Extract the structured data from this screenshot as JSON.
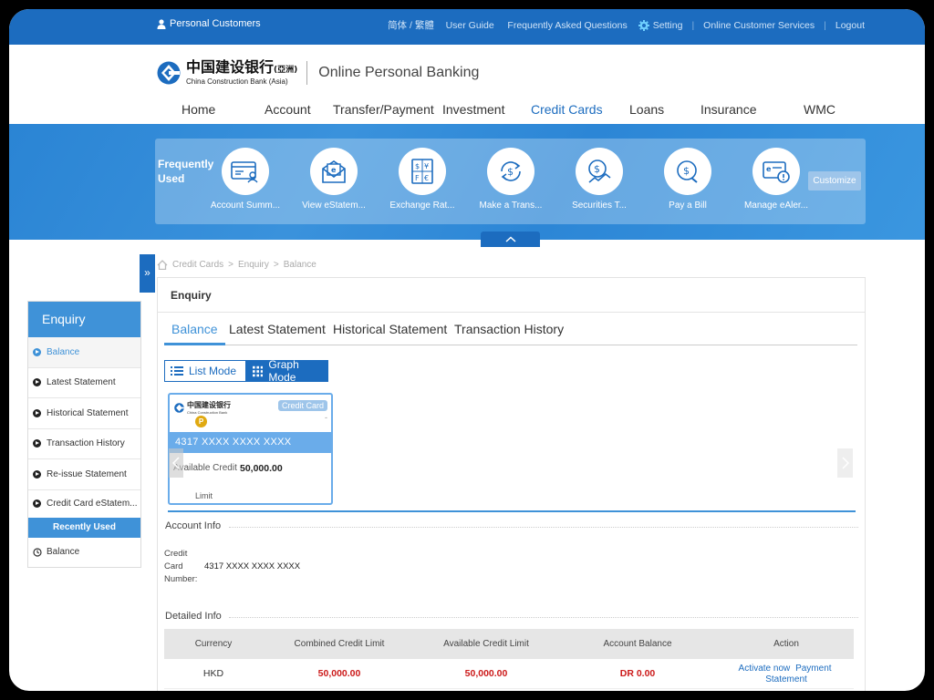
{
  "topbar": {
    "personal": "Personal Customers",
    "lang": "简体 / 繁體",
    "user_guide": "User Guide",
    "faq": "Frequently Asked Questions",
    "setting": "Setting",
    "online_services": "Online Customer Services",
    "logout": "Logout"
  },
  "header": {
    "bank_cn": "中国建设银行",
    "bank_cn_suffix": "(亞洲)",
    "bank_en": "China Construction Bank (Asia)",
    "product": "Online Personal Banking"
  },
  "nav": {
    "home": "Home",
    "account": "Account",
    "transfer": "Transfer/Payment",
    "investment": "Investment",
    "credit_cards": "Credit Cards",
    "loans": "Loans",
    "insurance": "Insurance",
    "wmc": "WMC"
  },
  "frequently_used": {
    "label": "Frequently Used",
    "customize": "Customize",
    "items": [
      {
        "label": "Account Summ...",
        "icon": "account-summary-icon"
      },
      {
        "label": "View eStatem...",
        "icon": "estatement-icon"
      },
      {
        "label": "Exchange Rat...",
        "icon": "exchange-rate-icon"
      },
      {
        "label": "Make a Trans...",
        "icon": "transfer-icon"
      },
      {
        "label": "Securities T...",
        "icon": "securities-icon"
      },
      {
        "label": "Pay a Bill",
        "icon": "pay-bill-icon"
      },
      {
        "label": "Manage eAler...",
        "icon": "ealert-icon"
      }
    ]
  },
  "sidebar": {
    "title": "Enquiry",
    "items": [
      {
        "label": "Balance"
      },
      {
        "label": "Latest Statement"
      },
      {
        "label": "Historical Statement"
      },
      {
        "label": "Transaction History"
      },
      {
        "label": "Re-issue Statement"
      },
      {
        "label": "Credit Card eStatem..."
      }
    ],
    "recently_used": "Recently Used",
    "recent_items": [
      {
        "label": "Balance"
      }
    ]
  },
  "breadcrumb": {
    "a": "Credit Cards",
    "b": "Enquiry",
    "c": "Balance",
    "sep": ">"
  },
  "content": {
    "title": "Enquiry",
    "tabs": [
      "Balance",
      "Latest Statement",
      "Historical Statement",
      "Transaction History"
    ],
    "list_mode": "List Mode",
    "graph_mode": "Graph Mode",
    "card": {
      "bank_cn": "中国建设银行",
      "bank_en": "China Construction Bank",
      "badge": "Credit Card",
      "coin": "P",
      "dash": "-",
      "number": "4317 XXXX XXXX XXXX",
      "available_label": "Available Credit",
      "limit_label": "Limit",
      "available_value": "50,000.00"
    },
    "account_info": {
      "heading": "Account Info",
      "label_l1": "Credit",
      "label_l2": "Card",
      "label_l3": "Number:",
      "value": "4317 XXXX XXXX XXXX"
    },
    "detailed_info": {
      "heading": "Detailed Info",
      "columns": [
        "Currency",
        "Combined Credit Limit",
        "Available Credit Limit",
        "Account Balance",
        "Action"
      ],
      "row": {
        "currency": "HKD",
        "combined": "50,000.00",
        "available": "50,000.00",
        "balance": "DR 0.00",
        "actions": [
          "Activate now",
          "Payment",
          "Statement"
        ]
      }
    }
  },
  "colors": {
    "brand": "#1c6cbf",
    "accent": "#3f92d8",
    "negative": "#cc1a1a"
  }
}
